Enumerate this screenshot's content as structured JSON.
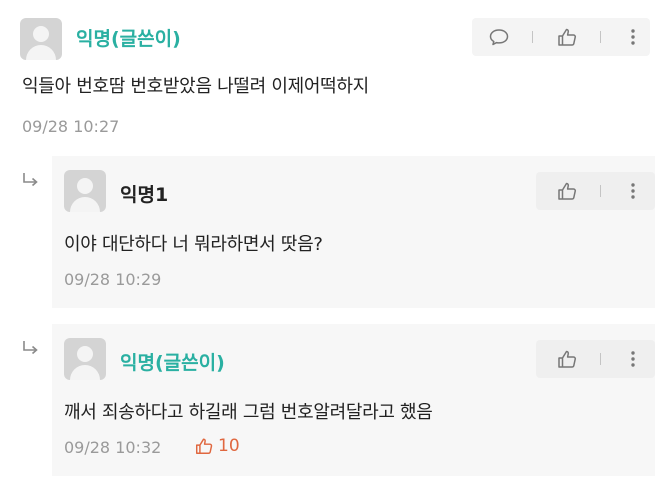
{
  "post": {
    "author": "익명(글쓴이)",
    "body": "익들아 번호땀 번호받았음 나떨려 이제어떡하지",
    "time": "09/28 10:27"
  },
  "replies": [
    {
      "author": "익명1",
      "body": "이야 대단하다 너 뭐라하면서 땃음?",
      "time": "09/28 10:29"
    },
    {
      "author": "익명(글쓴이)",
      "body": "깨서 죄송하다고 하길래 그럼 번호알려달라고 했음",
      "time": "09/28 10:32",
      "likes": "10"
    }
  ],
  "icons": {
    "comment": "comment-icon",
    "like": "thumbs-up-icon",
    "more": "more-vertical-icon",
    "reply": "reply-arrow-icon",
    "avatar": "default-avatar"
  },
  "colors": {
    "author": "#2ab0a2",
    "like_count": "#e0673f",
    "card_bg": "#f7f7f7",
    "timestamp": "#9a9a9a"
  }
}
